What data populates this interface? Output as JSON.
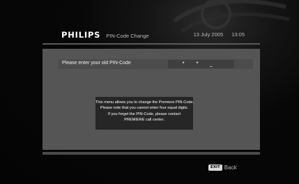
{
  "header": {
    "brand": "PHILIPS",
    "title": "PIN-Code Change",
    "date": "13 July 2005",
    "time": "13:05"
  },
  "pin_row": {
    "label": "Please enter your old PIN-Code",
    "digits": [
      "*",
      "*",
      "_"
    ]
  },
  "message": {
    "lines": [
      "This menu allows you to change the Premiere PIN-Code.",
      "Please note that you cannot enter four equal digits.",
      "If you forget the PIN-Code, please contact",
      "PREMIERE call center."
    ]
  },
  "footer": {
    "key": "EXIT",
    "label": "Back"
  },
  "colors": {
    "background": "#060606",
    "panel": "#555555",
    "message_box": "#262626",
    "text": "#ffffff"
  },
  "icons": [
    "film-reel-decoration-icon"
  ]
}
